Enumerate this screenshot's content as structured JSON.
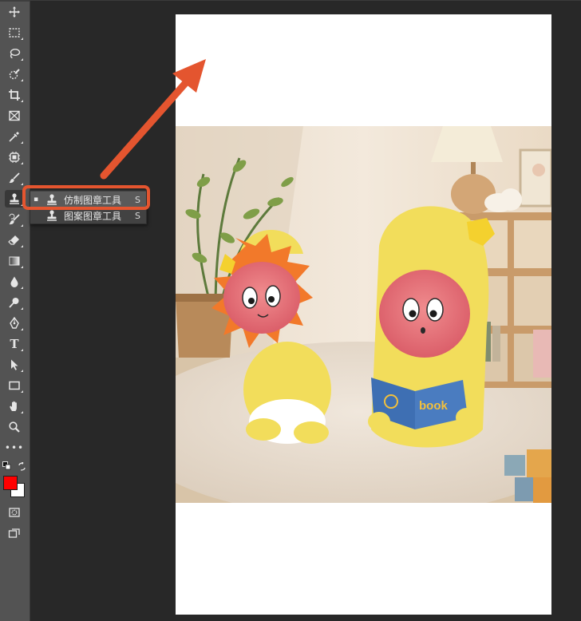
{
  "toolbar": {
    "tools": [
      {
        "name": "move-tool",
        "icon": "move-icon"
      },
      {
        "name": "marquee-tool",
        "icon": "marquee-icon"
      },
      {
        "name": "lasso-tool",
        "icon": "lasso-icon"
      },
      {
        "name": "quick-selection-tool",
        "icon": "quick-selection-icon"
      },
      {
        "name": "crop-tool",
        "icon": "crop-icon"
      },
      {
        "name": "frame-tool",
        "icon": "frame-icon"
      },
      {
        "name": "eyedropper-tool",
        "icon": "eyedropper-icon"
      },
      {
        "name": "spot-healing-tool",
        "icon": "healing-icon"
      },
      {
        "name": "brush-tool",
        "icon": "brush-icon"
      },
      {
        "name": "clone-stamp-tool",
        "icon": "stamp-icon",
        "active": true
      },
      {
        "name": "history-brush-tool",
        "icon": "history-brush-icon"
      },
      {
        "name": "eraser-tool",
        "icon": "eraser-icon"
      },
      {
        "name": "gradient-tool",
        "icon": "gradient-icon"
      },
      {
        "name": "blur-tool",
        "icon": "blur-icon"
      },
      {
        "name": "dodge-tool",
        "icon": "dodge-icon"
      },
      {
        "name": "pen-tool",
        "icon": "pen-icon"
      },
      {
        "name": "type-tool",
        "icon": "type-icon",
        "glyph": "T"
      },
      {
        "name": "path-selection-tool",
        "icon": "path-selection-icon"
      },
      {
        "name": "rectangle-tool",
        "icon": "rectangle-icon"
      },
      {
        "name": "hand-tool",
        "icon": "hand-icon"
      },
      {
        "name": "zoom-tool",
        "icon": "zoom-icon"
      },
      {
        "name": "edit-toolbar",
        "icon": "more-icon",
        "glyph": "•••"
      }
    ],
    "foreground_color": "#ff0000",
    "background_color": "#ffffff"
  },
  "flyout": {
    "items": [
      {
        "label": "仿制图章工具",
        "shortcut": "S",
        "selected": true,
        "bullet": "▪"
      },
      {
        "label": "图案图章工具",
        "shortcut": "S",
        "selected": false,
        "bullet": ""
      }
    ]
  },
  "annotation": {
    "color": "#e4552f"
  },
  "canvas": {
    "document_color": "#ffffff",
    "photo_text": "book"
  }
}
